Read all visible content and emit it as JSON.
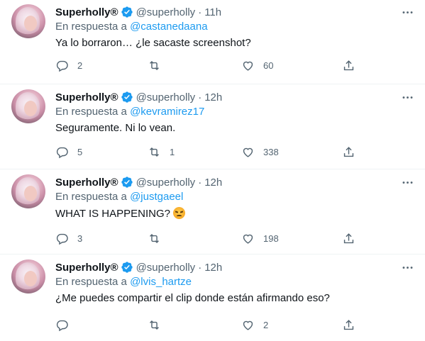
{
  "tweets": [
    {
      "author_name": "Superholly®",
      "handle": "@superholly",
      "separator": "·",
      "time": "11h",
      "reply_prefix": "En respuesta a",
      "reply_to": "@castanedaana",
      "text": "Ya lo borraron… ¿le sacaste screenshot?",
      "emoji": "",
      "replies": "2",
      "retweets": "",
      "likes": "60"
    },
    {
      "author_name": "Superholly®",
      "handle": "@superholly",
      "separator": "·",
      "time": "12h",
      "reply_prefix": "En respuesta a",
      "reply_to": "@kevramirez17",
      "text": "Seguramente. Ni lo vean.",
      "emoji": "",
      "replies": "5",
      "retweets": "1",
      "likes": "338"
    },
    {
      "author_name": "Superholly®",
      "handle": "@superholly",
      "separator": "·",
      "time": "12h",
      "reply_prefix": "En respuesta a",
      "reply_to": "@justgaeel",
      "text": "WHAT IS HAPPENING?",
      "emoji": "angry-face-emoji",
      "replies": "3",
      "retweets": "",
      "likes": "198"
    },
    {
      "author_name": "Superholly®",
      "handle": "@superholly",
      "separator": "·",
      "time": "12h",
      "reply_prefix": "En respuesta a",
      "reply_to": "@lvis_hartze",
      "text": "¿Me puedes compartir el clip donde están afirmando eso?",
      "emoji": "",
      "replies": "",
      "retweets": "",
      "likes": "2"
    }
  ],
  "colors": {
    "accent": "#1d9bf0",
    "secondary_text": "#536471",
    "primary_text": "#0f1419",
    "divider": "#eff3f4"
  },
  "icons": [
    "verified-badge-icon",
    "more-icon",
    "reply-icon",
    "retweet-icon",
    "like-icon",
    "share-icon"
  ]
}
